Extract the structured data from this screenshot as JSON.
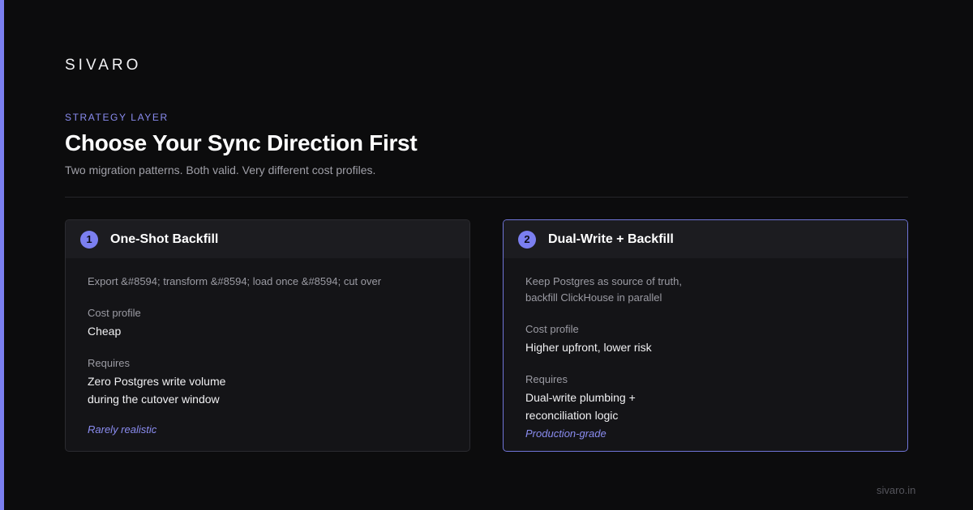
{
  "brand": "SIVARO",
  "eyebrow": "STRATEGY LAYER",
  "title": "Choose Your Sync Direction First",
  "subtitle": "Two migration patterns. Both valid. Very different cost profiles.",
  "colors": {
    "accent": "#7b7ff0",
    "background": "#0c0c0d",
    "card": "#141417",
    "card_header": "#1c1c20"
  },
  "cards": [
    {
      "number": "1",
      "title": "One-Shot Backfill",
      "description": "Export &#8594; transform &#8594; load once &#8594; cut over",
      "cost_label": "Cost profile",
      "cost_value": "Cheap",
      "requires_label": "Requires",
      "requires_value": "Zero Postgres write volume\nduring the cutover window",
      "tag": "Rarely realistic",
      "highlighted": false
    },
    {
      "number": "2",
      "title": "Dual-Write + Backfill",
      "description": "Keep Postgres as source of truth,\nbackfill ClickHouse in parallel",
      "cost_label": "Cost profile",
      "cost_value": "Higher upfront, lower risk",
      "requires_label": "Requires",
      "requires_value": "Dual-write plumbing +\nreconciliation logic",
      "tag": "Production-grade",
      "highlighted": true
    }
  ],
  "footer": "sivaro.in"
}
